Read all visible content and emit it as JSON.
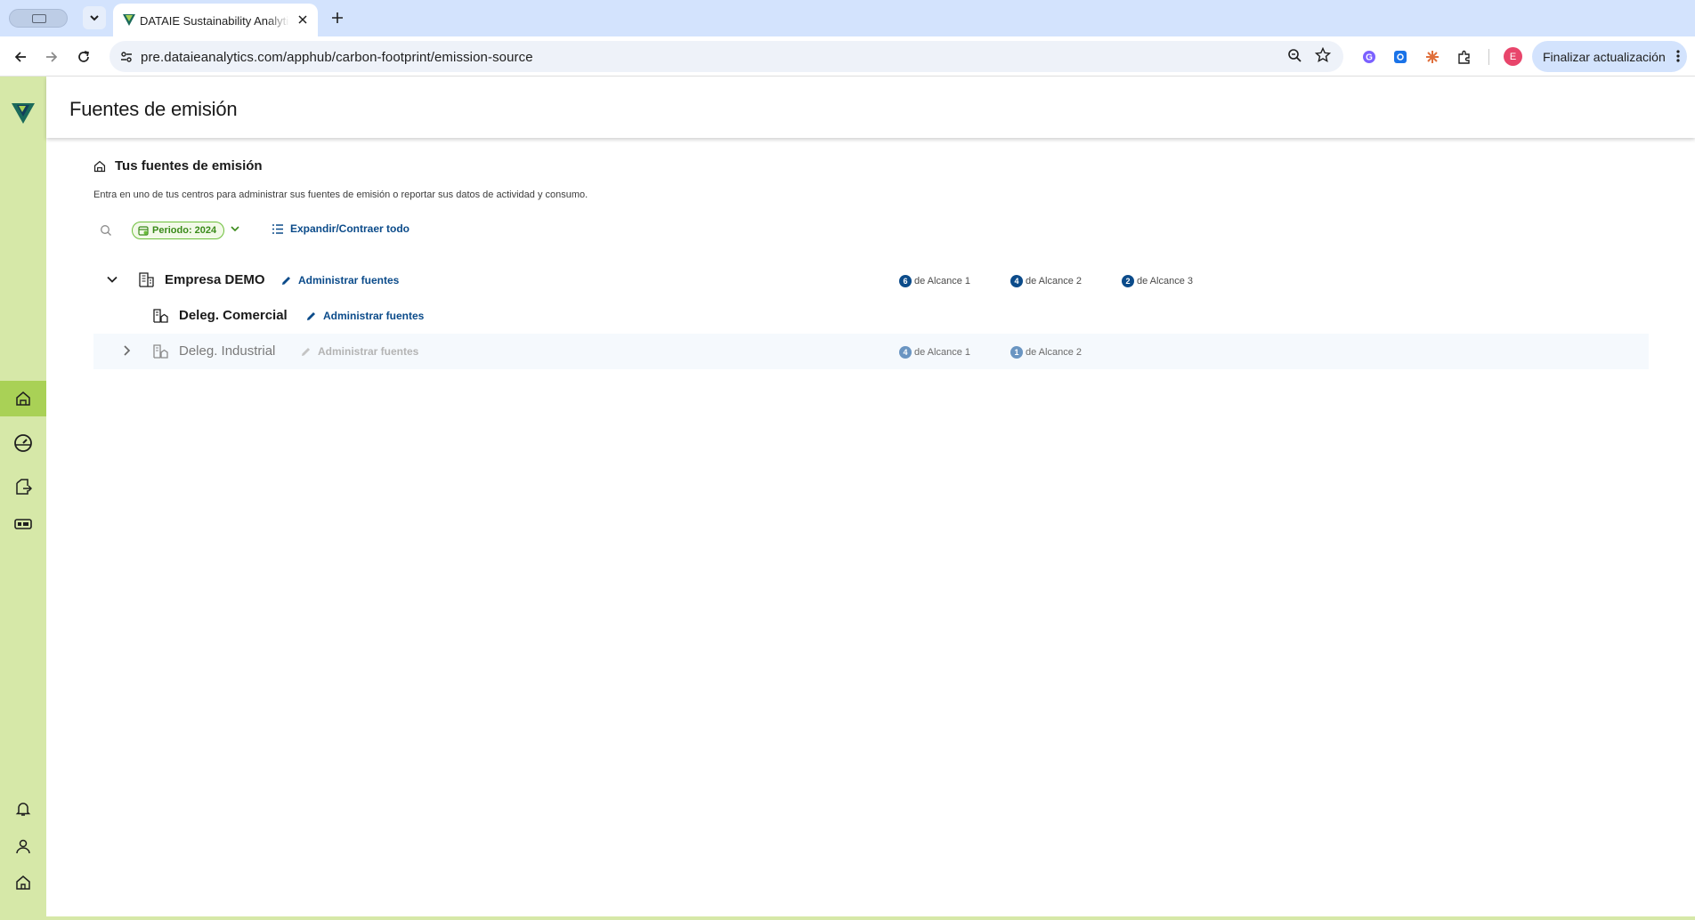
{
  "browser": {
    "tab_title": "DATAIE Sustainability Analytics",
    "url": "pre.dataieanalytics.com/apphub/carbon-footprint/emission-source",
    "profile_initial": "E",
    "update_label": "Finalizar actualización"
  },
  "page": {
    "title": "Fuentes de emisión",
    "section_title": "Tus fuentes de emisión",
    "subtitle": "Entra en uno de tus centros para administrar sus fuentes de emisión o reportar sus datos de actividad y consumo.",
    "period_label": "Periodo: 2024",
    "expand_label": "Expandir/Contraer todo"
  },
  "tree": {
    "admin_label": "Administrar fuentes",
    "rows": [
      {
        "name": "Empresa DEMO",
        "scopes": [
          {
            "count": "6",
            "label": "de Alcance 1"
          },
          {
            "count": "4",
            "label": "de Alcance 2"
          },
          {
            "count": "2",
            "label": "de Alcance 3"
          }
        ]
      },
      {
        "name": "Deleg. Comercial",
        "scopes": []
      },
      {
        "name": "Deleg. Industrial",
        "scopes": [
          {
            "count": "4",
            "label": "de Alcance 1"
          },
          {
            "count": "1",
            "label": "de Alcance 2"
          }
        ]
      }
    ]
  },
  "colors": {
    "sidebar": "#d6e8a8",
    "sidebar_active": "#a9d156",
    "accent_blue": "#0b4b8a",
    "period_green": "#6cbf3a"
  }
}
